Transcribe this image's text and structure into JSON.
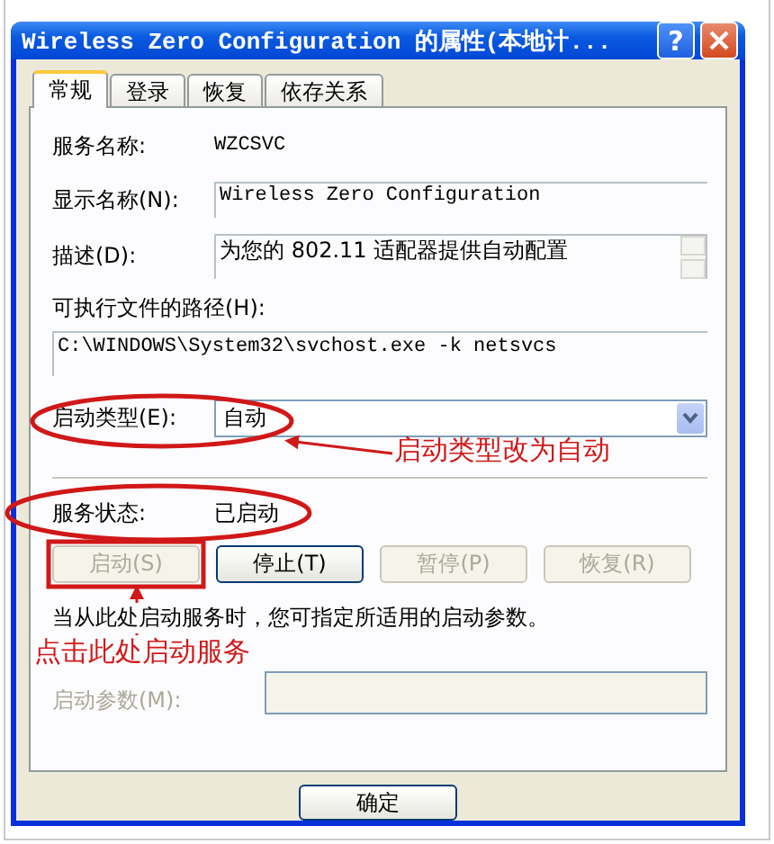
{
  "window": {
    "title": "Wireless Zero Configuration 的属性(本地计...",
    "help_glyph": "?"
  },
  "tabs": [
    {
      "label": "常规",
      "selected": true
    },
    {
      "label": "登录",
      "selected": false
    },
    {
      "label": "恢复",
      "selected": false
    },
    {
      "label": "依存关系",
      "selected": false
    }
  ],
  "fields": [
    {
      "kind": "text",
      "label": "服务名称:",
      "value": "WZCSVC"
    },
    {
      "kind": "input",
      "label": "显示名称(N):",
      "value": "Wireless Zero Configuration"
    },
    {
      "kind": "textarea",
      "label": "描述(D):",
      "value": "为您的 802.11 适配器提供自动配置"
    }
  ],
  "path": {
    "label": "可执行文件的路径(H):",
    "value": "C:\\WINDOWS\\System32\\svchost.exe -k netsvcs"
  },
  "startup_type": {
    "label": "启动类型(E):",
    "value": "自动"
  },
  "service_status": {
    "label": "服务状态:",
    "value": "已启动"
  },
  "service_buttons": [
    {
      "label": "启动(S)",
      "disabled": true
    },
    {
      "label": "停止(T)",
      "disabled": false
    },
    {
      "label": "暂停(P)",
      "disabled": true
    },
    {
      "label": "恢复(R)",
      "disabled": true
    }
  ],
  "hint": "当从此处启动服务时，您可指定所适用的启动参数。",
  "start_params": {
    "label": "启动参数(M):",
    "disabled": true
  },
  "dialog_buttons": [
    {
      "label": "确定"
    }
  ],
  "annotations": [
    {
      "kind": "type",
      "text": "启动类型改为自动"
    },
    {
      "kind": "start",
      "text": "点击此处启动服务"
    }
  ]
}
